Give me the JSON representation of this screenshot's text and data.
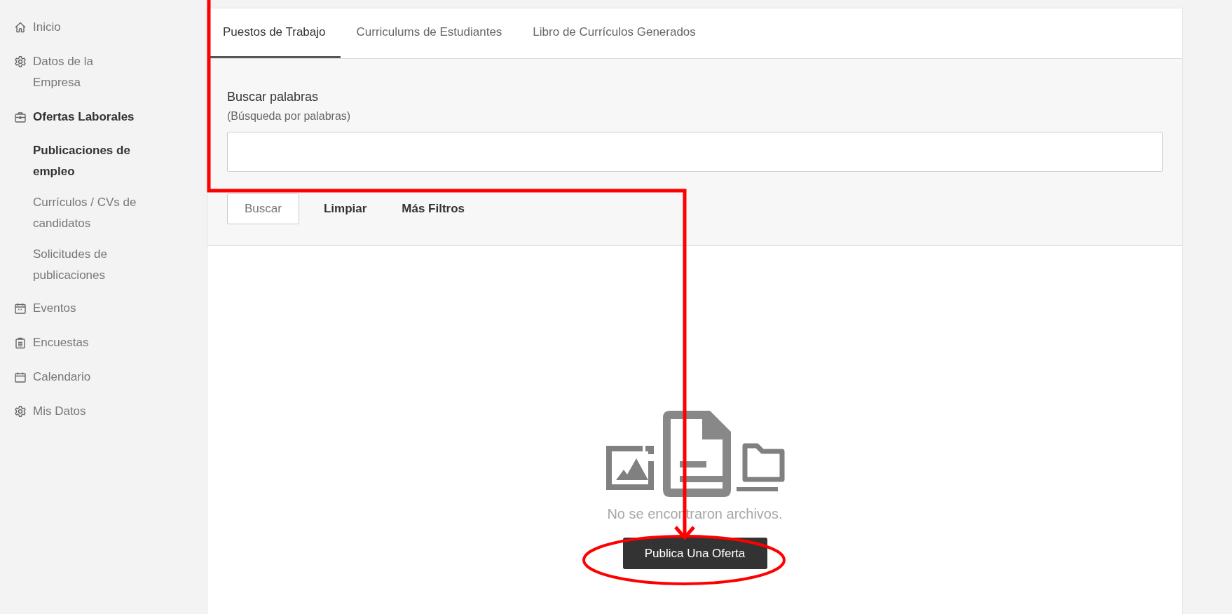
{
  "sidebar": {
    "items": [
      {
        "label": "Inicio",
        "kind": "home",
        "selected": false
      },
      {
        "label": "Datos de la Empresa",
        "kind": "gear",
        "selected": false
      },
      {
        "label": "Ofertas Laborales",
        "kind": "briefcase",
        "selected": true,
        "children": [
          {
            "label": "Publicaciones de empleo",
            "selected": true
          },
          {
            "label": "Currículos / CVs de candidatos",
            "selected": false
          },
          {
            "label": "Solicitudes de publicaciones",
            "selected": false
          }
        ]
      },
      {
        "label": "Eventos",
        "kind": "event",
        "selected": false
      },
      {
        "label": "Encuestas",
        "kind": "clipboard",
        "selected": false
      },
      {
        "label": "Calendario",
        "kind": "calendar",
        "selected": false
      },
      {
        "label": "Mis Datos",
        "kind": "gear",
        "selected": false
      }
    ]
  },
  "tabs": [
    {
      "label": "Puestos de Trabajo",
      "selected": true
    },
    {
      "label": "Curriculums de Estudiantes",
      "selected": false
    },
    {
      "label": "Libro de Currículos Generados",
      "selected": false
    }
  ],
  "search": {
    "label": "Buscar palabras",
    "hint": "(Búsqueda por palabras)",
    "buttons": [
      {
        "label": "Buscar",
        "kind": "outlined"
      },
      {
        "label": "Limpiar",
        "kind": "text"
      },
      {
        "label": "Más Filtros",
        "kind": "text"
      }
    ]
  },
  "empty_state": {
    "message": "No se encontraron archivos.",
    "button": "Publica Una Oferta"
  }
}
